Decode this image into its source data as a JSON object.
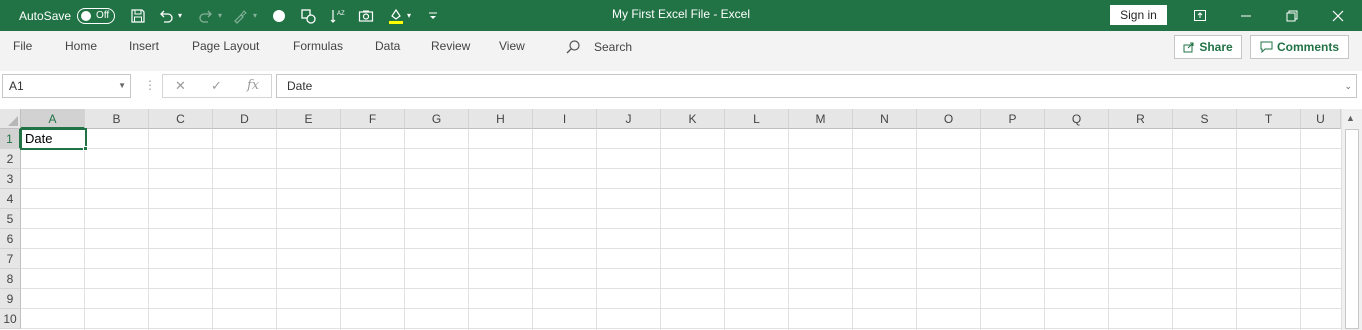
{
  "titlebar": {
    "autosave_label": "AutoSave",
    "autosave_state": "Off",
    "document_title": "My First Excel File  -  Excel",
    "sign_in": "Sign in",
    "accent_color": "#217346"
  },
  "menu": {
    "items": [
      "File",
      "Home",
      "Insert",
      "Page Layout",
      "Formulas",
      "Data",
      "Review",
      "View"
    ],
    "search_label": "Search",
    "share_label": "Share",
    "comments_label": "Comments"
  },
  "formula_bar": {
    "name_box": "A1",
    "formula": "Date"
  },
  "sheet": {
    "columns": [
      "A",
      "B",
      "C",
      "D",
      "E",
      "F",
      "G",
      "H",
      "I",
      "J",
      "K",
      "L",
      "M",
      "N",
      "O",
      "P",
      "Q",
      "R",
      "S",
      "T",
      "U"
    ],
    "rows": [
      "1",
      "2",
      "3",
      "4",
      "5",
      "6",
      "7",
      "8",
      "9",
      "10"
    ],
    "active_cell_value": "Date"
  }
}
